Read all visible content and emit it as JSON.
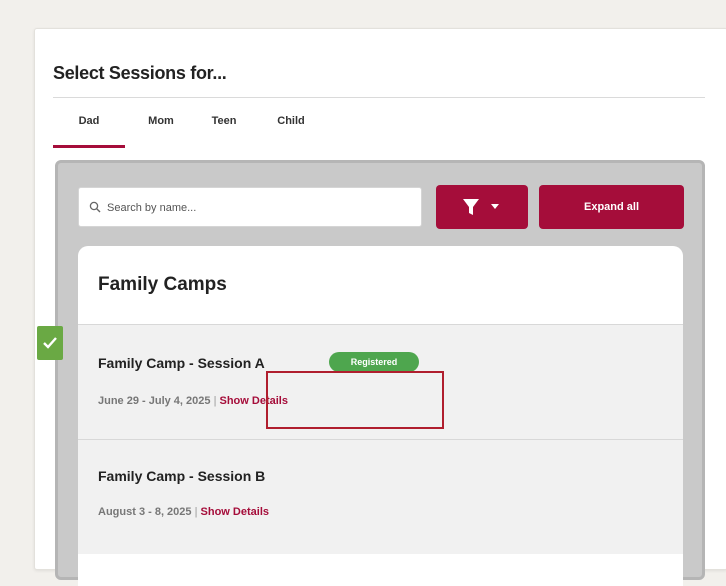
{
  "panel": {
    "title": "Select Sessions for..."
  },
  "tabs": [
    {
      "label": "Dad",
      "active": true
    },
    {
      "label": "Mom",
      "active": false
    },
    {
      "label": "Teen",
      "active": false
    },
    {
      "label": "Child",
      "active": false
    }
  ],
  "search": {
    "placeholder": "Search by name..."
  },
  "toolbar": {
    "expand_label": "Expand all"
  },
  "category": {
    "title": "Family Camps"
  },
  "sessions": [
    {
      "name": "Family Camp - Session A",
      "badge": "Registered",
      "dates": "June 29 - July 4, 2025",
      "separator": "|",
      "details_label": "Show Details",
      "selected": true
    },
    {
      "name": "Family Camp - Session B",
      "dates": "August 3 - 8, 2025",
      "separator": "|",
      "details_label": "Show Details",
      "selected": false
    }
  ],
  "colors": {
    "accent": "#a50d3a",
    "registered": "#4ea64e",
    "check": "#6aa944",
    "highlight": "#b01e2e"
  }
}
